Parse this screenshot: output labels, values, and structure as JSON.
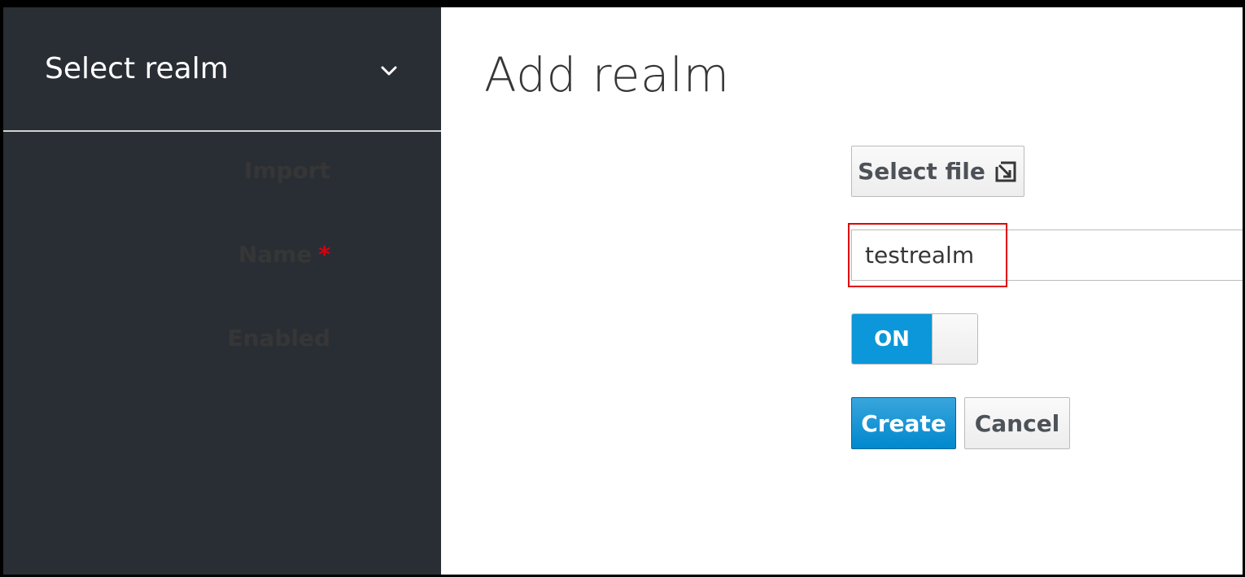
{
  "sidebar": {
    "realm_select_label": "Select realm",
    "realm_select_icon": "chevron-down-icon"
  },
  "main": {
    "title": "Add realm",
    "form": {
      "import_label": "Import",
      "select_file_label": "Select file",
      "select_file_icon": "import-arrow-icon",
      "name_label": "Name",
      "name_required_marker": "*",
      "name_value": "testrealm",
      "enabled_label": "Enabled",
      "enabled_state": "ON",
      "create_label": "Create",
      "cancel_label": "Cancel"
    }
  },
  "colors": {
    "sidebar_bg": "#292e34",
    "primary": "#0088ce",
    "toggle_on": "#0b97d9",
    "required": "#d9000e",
    "highlight": "#e00000"
  }
}
